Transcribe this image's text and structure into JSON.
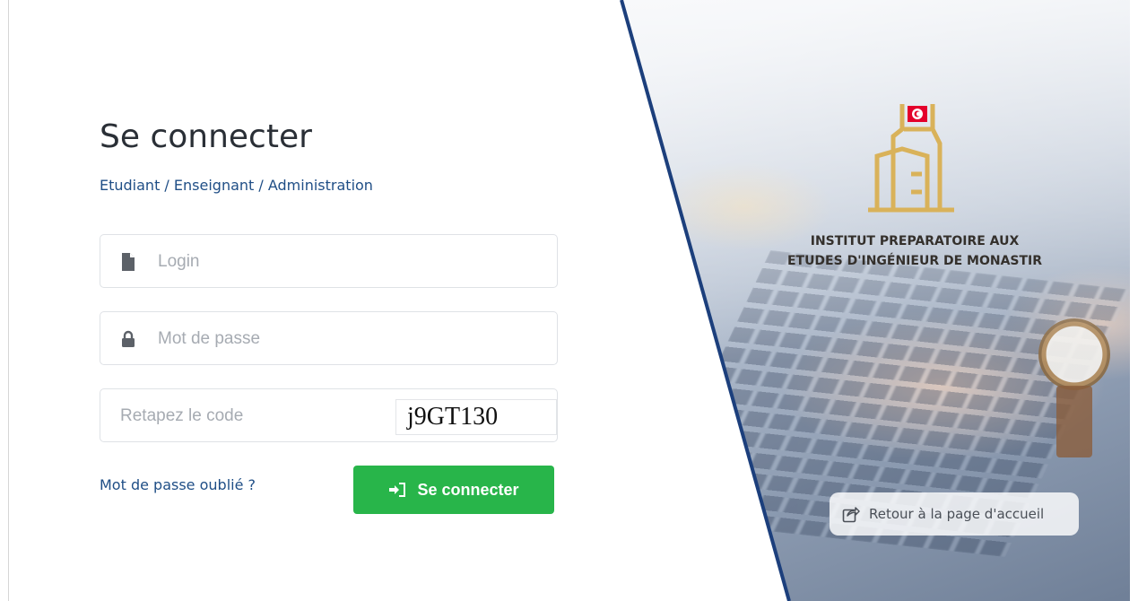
{
  "form": {
    "title": "Se connecter",
    "subtitle": "Etudiant / Enseignant / Administration",
    "login_placeholder": "Login",
    "password_placeholder": "Mot de passe",
    "code_placeholder": "Retapez le code",
    "captcha_text": "j9GT130",
    "forgot_link": "Mot de passe oublié ?",
    "submit_label": "Se connecter"
  },
  "institution": {
    "line1": "INSTITUT PREPARATOIRE AUX",
    "line2": "ETUDES D'INGÉNIEUR DE MONASTIR"
  },
  "home_button": {
    "label": "Retour à la page d'accueil"
  },
  "icons": {
    "login_field": "file-icon",
    "password_field": "lock-icon",
    "submit": "sign-in-icon",
    "home": "share-icon",
    "logo": "institution-logo-icon"
  },
  "colors": {
    "primary_text": "#1f4e86",
    "submit_button": "#28b54a",
    "logo_gold": "#d9b25a",
    "diagonal_line": "#1c3f7c",
    "flag_red": "#e4002b"
  }
}
